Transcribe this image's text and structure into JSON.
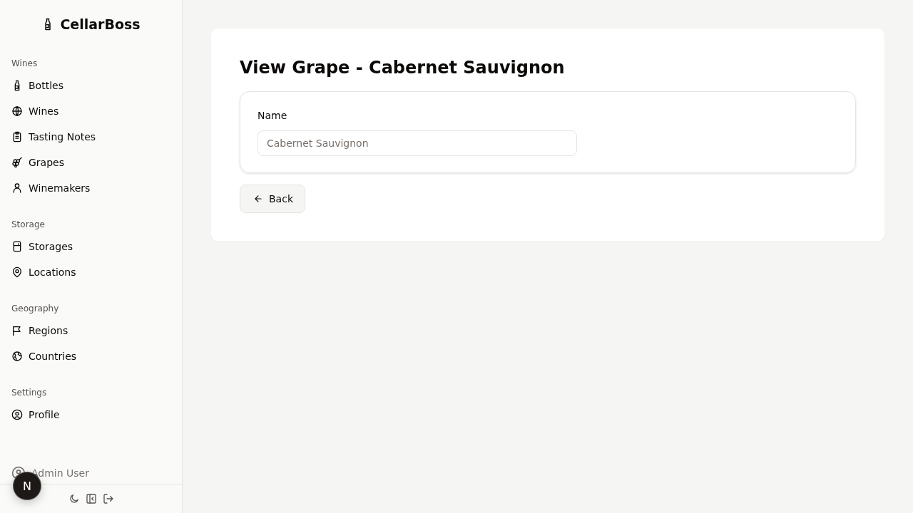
{
  "brand": {
    "name": "CellarBoss"
  },
  "sidebar": {
    "sections": [
      {
        "title": "Wines",
        "items": [
          {
            "label": "Bottles",
            "selected": false
          },
          {
            "label": "Wines",
            "selected": false
          },
          {
            "label": "Tasting Notes",
            "selected": false
          },
          {
            "label": "Grapes",
            "selected": false
          },
          {
            "label": "Winemakers",
            "selected": false
          }
        ]
      },
      {
        "title": "Storage",
        "items": [
          {
            "label": "Storages",
            "selected": false
          },
          {
            "label": "Locations",
            "selected": false
          }
        ]
      },
      {
        "title": "Geography",
        "items": [
          {
            "label": "Regions",
            "selected": false
          },
          {
            "label": "Countries",
            "selected": false
          }
        ]
      },
      {
        "title": "Settings",
        "items": [
          {
            "label": "Profile",
            "selected": false
          }
        ]
      }
    ],
    "user": {
      "name": "Admin User"
    }
  },
  "dev_badge": {
    "letter": "N"
  },
  "page": {
    "title": "View Grape - Cabernet Sauvignon",
    "fields": [
      {
        "label": "Name",
        "value": "Cabernet Sauvignon",
        "disabled": true
      }
    ],
    "buttons": [
      {
        "label": "Back"
      }
    ]
  }
}
